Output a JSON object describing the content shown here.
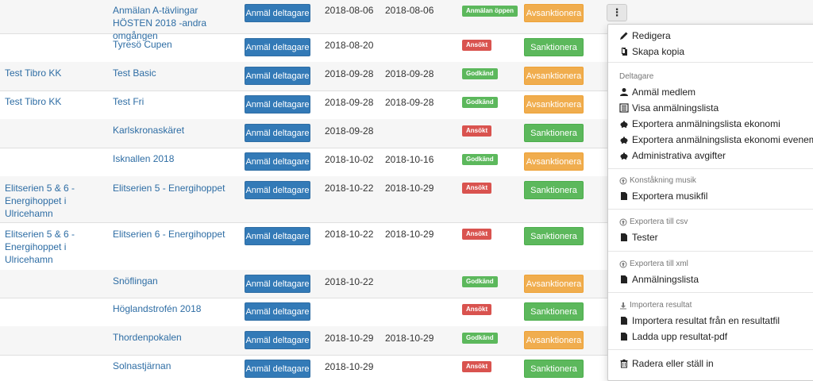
{
  "table": {
    "rows": [
      {
        "club": "",
        "event": "Anmälan A-tävlingar HÖSTEN 2018 -andra omgången",
        "register": "Anmäl deltagare",
        "date_start": "2018-08-06",
        "date_end": "2018-08-06",
        "status": "Anmälan öppen",
        "status_color": "green",
        "sanction": "Avsanktionera",
        "sanction_color": "orange"
      },
      {
        "club": "",
        "event": "Tyresö Cupen",
        "register": "Anmäl deltagare",
        "date_start": "2018-08-20",
        "date_end": "",
        "status": "Ansökt",
        "status_color": "red",
        "sanction": "Sanktionera",
        "sanction_color": "green"
      },
      {
        "club": "Test Tibro KK",
        "event": "Test Basic",
        "register": "Anmäl deltagare",
        "date_start": "2018-09-28",
        "date_end": "2018-09-28",
        "status": "Godkänd",
        "status_color": "green",
        "sanction": "Avsanktionera",
        "sanction_color": "orange"
      },
      {
        "club": "Test Tibro KK",
        "event": "Test Fri",
        "register": "Anmäl deltagare",
        "date_start": "2018-09-28",
        "date_end": "2018-09-28",
        "status": "Godkänd",
        "status_color": "green",
        "sanction": "Avsanktionera",
        "sanction_color": "orange"
      },
      {
        "club": "",
        "event": "Karlskronaskäret",
        "register": "Anmäl deltagare",
        "date_start": "2018-09-28",
        "date_end": "",
        "status": "Ansökt",
        "status_color": "red",
        "sanction": "Sanktionera",
        "sanction_color": "green"
      },
      {
        "club": "",
        "event": "Isknallen 2018",
        "register": "Anmäl deltagare",
        "date_start": "2018-10-02",
        "date_end": "2018-10-16",
        "status": "Godkänd",
        "status_color": "green",
        "sanction": "Avsanktionera",
        "sanction_color": "orange"
      },
      {
        "club": "Elitserien 5 & 6 - Energihoppet i Ulricehamn",
        "event": "Elitserien 5 - Energihoppet",
        "register": "Anmäl deltagare",
        "date_start": "2018-10-22",
        "date_end": "2018-10-29",
        "status": "Ansökt",
        "status_color": "red",
        "sanction": "Sanktionera",
        "sanction_color": "green"
      },
      {
        "club": "Elitserien 5 & 6 - Energihoppet i Ulricehamn",
        "event": "Elitserien 6 - Energihoppet",
        "register": "Anmäl deltagare",
        "date_start": "2018-10-22",
        "date_end": "2018-10-29",
        "status": "Ansökt",
        "status_color": "red",
        "sanction": "Sanktionera",
        "sanction_color": "green"
      },
      {
        "club": "",
        "event": "Snöflingan",
        "register": "Anmäl deltagare",
        "date_start": "2018-10-22",
        "date_end": "",
        "status": "Godkänd",
        "status_color": "green",
        "sanction": "Avsanktionera",
        "sanction_color": "orange"
      },
      {
        "club": "",
        "event": "Höglandstrofén 2018",
        "register": "Anmäl deltagare",
        "date_start": "",
        "date_end": "",
        "status": "Ansökt",
        "status_color": "red",
        "sanction": "Sanktionera",
        "sanction_color": "green"
      },
      {
        "club": "",
        "event": "Thordenpokalen",
        "register": "Anmäl deltagare",
        "date_start": "2018-10-29",
        "date_end": "2018-10-29",
        "status": "Godkänd",
        "status_color": "green",
        "sanction": "Avsanktionera",
        "sanction_color": "orange"
      },
      {
        "club": "",
        "event": "Solnastjärnan",
        "register": "Anmäl deltagare",
        "date_start": "2018-10-29",
        "date_end": "",
        "status": "Ansökt",
        "status_color": "red",
        "sanction": "Sanktionera",
        "sanction_color": "green"
      }
    ]
  },
  "menu": {
    "kebab_label": "⋮",
    "edit": "Redigera",
    "copy": "Skapa kopia",
    "participants_header": "Deltagare",
    "register_member": "Anmäl medlem",
    "show_list": "Visa anmälningslista",
    "export_economy": "Exportera anmälningslista ekonomi",
    "export_economy_events": "Exportera anmälningslista ekonomi evenemang",
    "admin_fees": "Administrativa avgifter",
    "music_header": "Konståkning musik",
    "export_music": "Exportera musikfil",
    "csv_header": "Exportera till csv",
    "csv_testers": "Tester",
    "xml_header": "Exportera till xml",
    "xml_list": "Anmälningslista",
    "import_header": "Importera resultat",
    "import_file": "Importera resultat från en resultatfil",
    "upload_pdf": "Ladda upp resultat-pdf",
    "delete": "Radera eller ställ in"
  },
  "colors": {
    "primary": "#337ab7",
    "success": "#5cb85c",
    "warning": "#f0ad4e",
    "danger": "#d9534f",
    "link": "#2e6da4"
  }
}
